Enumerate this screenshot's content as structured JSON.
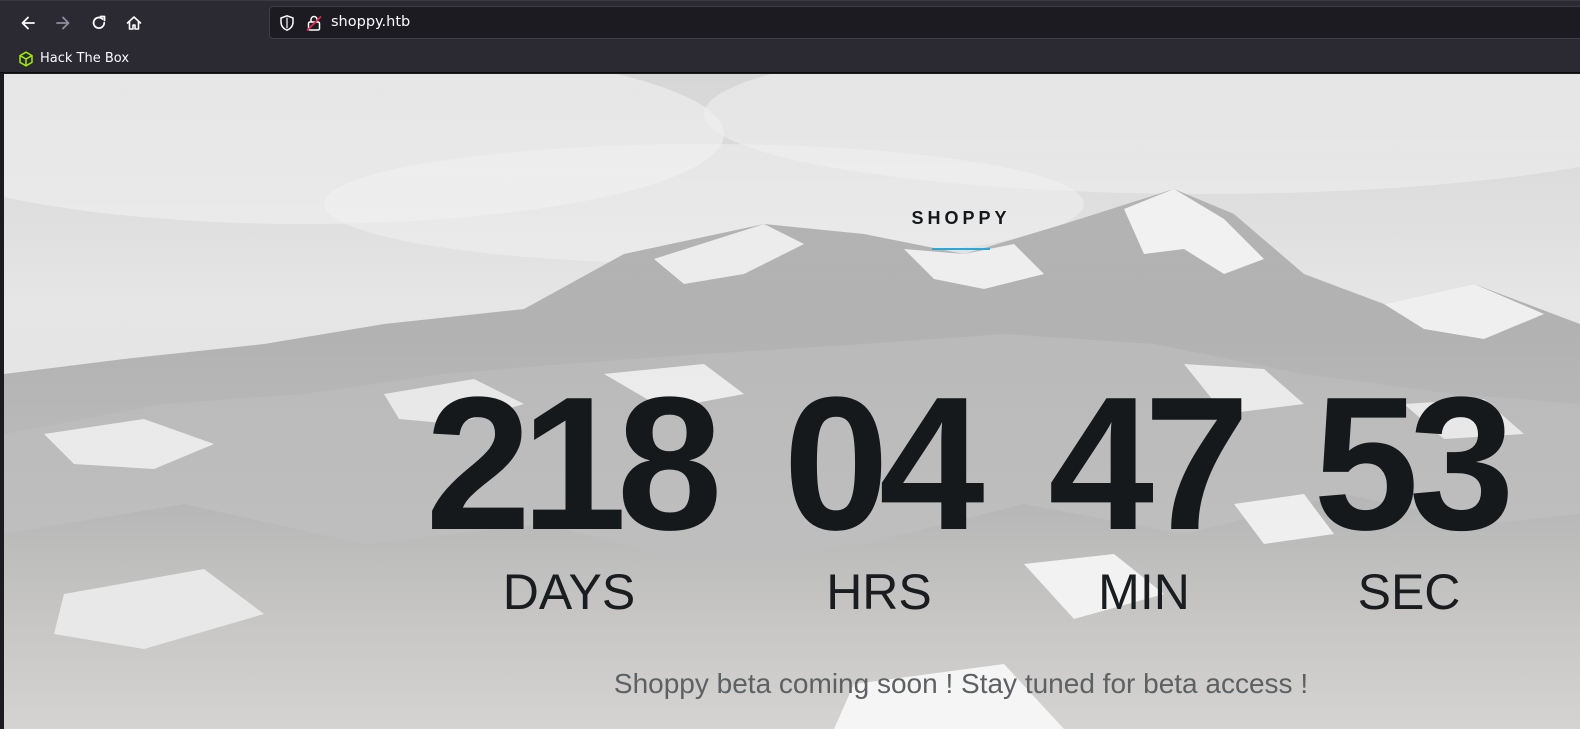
{
  "browser": {
    "url": "shoppy.htb",
    "bookmarks": [
      {
        "label": "Hack The Box",
        "icon": "hackthebox-cube-icon",
        "color": "#9fef00"
      }
    ]
  },
  "page": {
    "brand": "SHOPPY",
    "accent_color": "#2aa8d8",
    "countdown": {
      "days": {
        "value": "218",
        "label": "DAYS"
      },
      "hours": {
        "value": "04",
        "label": "HRS"
      },
      "minutes": {
        "value": "47",
        "label": "MIN"
      },
      "seconds": {
        "value": "53",
        "label": "SEC"
      }
    },
    "tagline": "Shoppy beta coming soon ! Stay tuned for beta access !"
  }
}
